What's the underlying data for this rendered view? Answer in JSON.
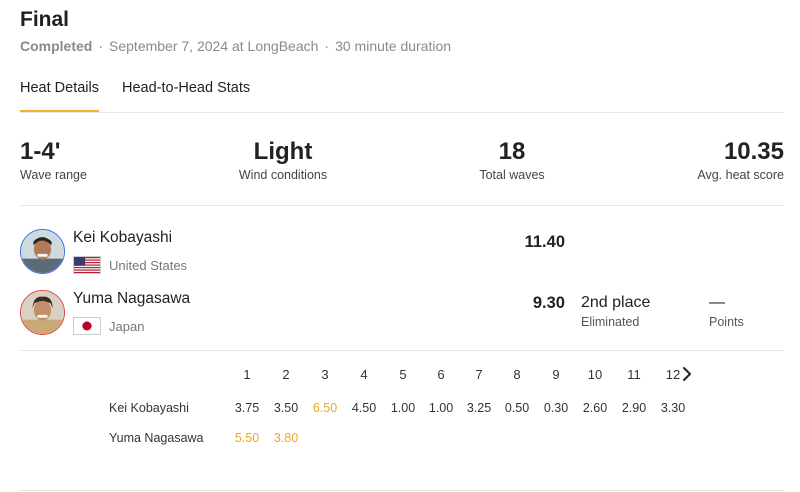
{
  "header": {
    "title": "Final",
    "status": "Completed",
    "separator": "·",
    "date_location": "September 7, 2024 at LongBeach",
    "duration": "30 minute duration"
  },
  "tabs": [
    {
      "label": "Heat Details",
      "active": true
    },
    {
      "label": "Head-to-Head Stats",
      "active": false
    }
  ],
  "stats": [
    {
      "value": "1-4'",
      "label": "Wave range"
    },
    {
      "value": "Light",
      "label": "Wind conditions"
    },
    {
      "value": "18",
      "label": "Total waves"
    },
    {
      "value": "10.35",
      "label": "Avg. heat score"
    }
  ],
  "surfers": [
    {
      "name": "Kei Kobayashi",
      "country": "United States",
      "flag_icon": "us-flag-icon",
      "total": "11.40",
      "ring_color": "#3a6ee0"
    },
    {
      "name": "Yuma Nagasawa",
      "country": "Japan",
      "flag_icon": "japan-flag-icon",
      "total": "9.30",
      "place": "2nd place",
      "status": "Eliminated",
      "points_value": "—",
      "points_label": "Points",
      "ring_color": "#e0463a"
    }
  ],
  "wave_table": {
    "wave_numbers": [
      "1",
      "2",
      "3",
      "4",
      "5",
      "6",
      "7",
      "8",
      "9",
      "10",
      "11",
      "12"
    ],
    "rows": [
      {
        "name": "Kei Kobayashi",
        "scores": [
          "3.75",
          "3.50",
          "6.50",
          "4.50",
          "1.00",
          "1.00",
          "3.25",
          "0.50",
          "0.30",
          "2.60",
          "2.90",
          "3.30"
        ],
        "highlight": [
          2
        ]
      },
      {
        "name": "Yuma Nagasawa",
        "scores": [
          "5.50",
          "3.80"
        ],
        "highlight": [
          0,
          1
        ]
      }
    ],
    "highlight_color": "#f2a51f",
    "next_icon": "chevron-right-icon"
  }
}
